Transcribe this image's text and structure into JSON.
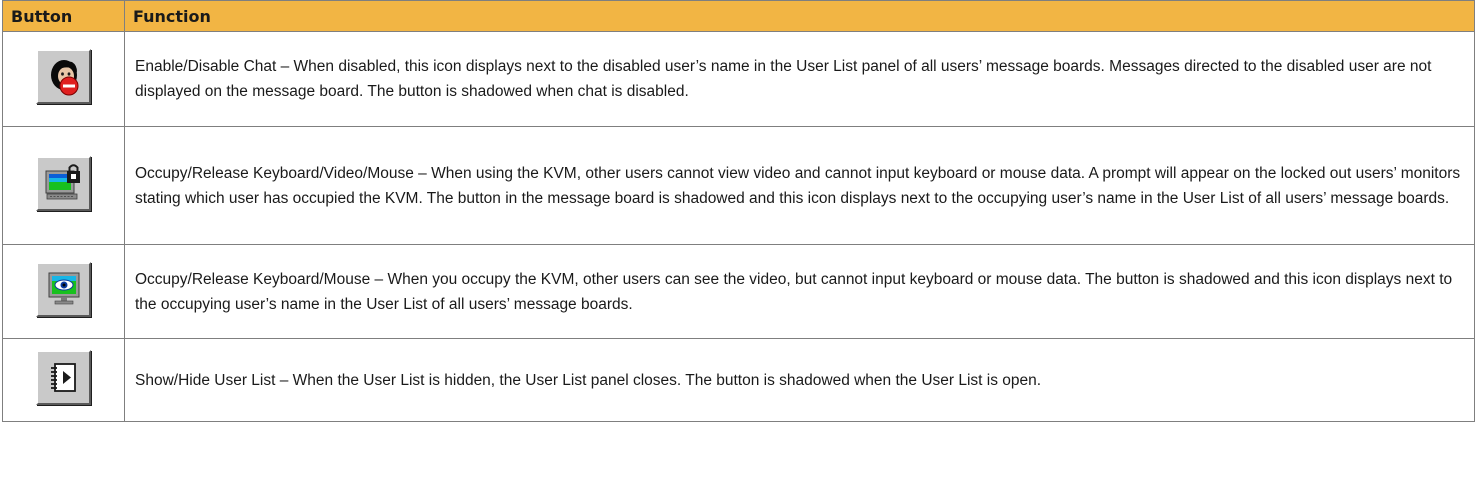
{
  "table": {
    "headers": {
      "button": "Button",
      "function": "Function"
    },
    "rows": [
      {
        "icon": "chat-disabled-icon",
        "description": "Enable/Disable Chat – When disabled, this icon displays next to the disabled user’s name in the User List panel of all users’ message boards. Messages directed to the disabled user are not displayed on the message board. The button is shadowed when chat is disabled."
      },
      {
        "icon": "kvm-locked-monitor-icon",
        "description": "Occupy/Release Keyboard/Video/Mouse – When using the KVM, other users cannot view video and cannot input keyboard or mouse data. A prompt will appear on the locked out users’ monitors stating which user has occupied the KVM. The button in the message board is shadowed and this icon displays next to the occupying user’s name in the User List of all users’ message boards."
      },
      {
        "icon": "keyboard-mouse-eye-monitor-icon",
        "description": "Occupy/Release Keyboard/Mouse – When you occupy the KVM, other users can see the video, but cannot input keyboard or mouse data. The button is shadowed and this icon displays next to the occupying user’s name in the User List of all users’ message boards."
      },
      {
        "icon": "user-list-toggle-icon",
        "description": "Show/Hide User List – When the User List is hidden, the User List panel closes. The button is shadowed when the User List is open."
      }
    ]
  },
  "colors": {
    "header_background": "#f2b544",
    "button_face": "#c9c9c9",
    "border": "#7f7f7f"
  }
}
